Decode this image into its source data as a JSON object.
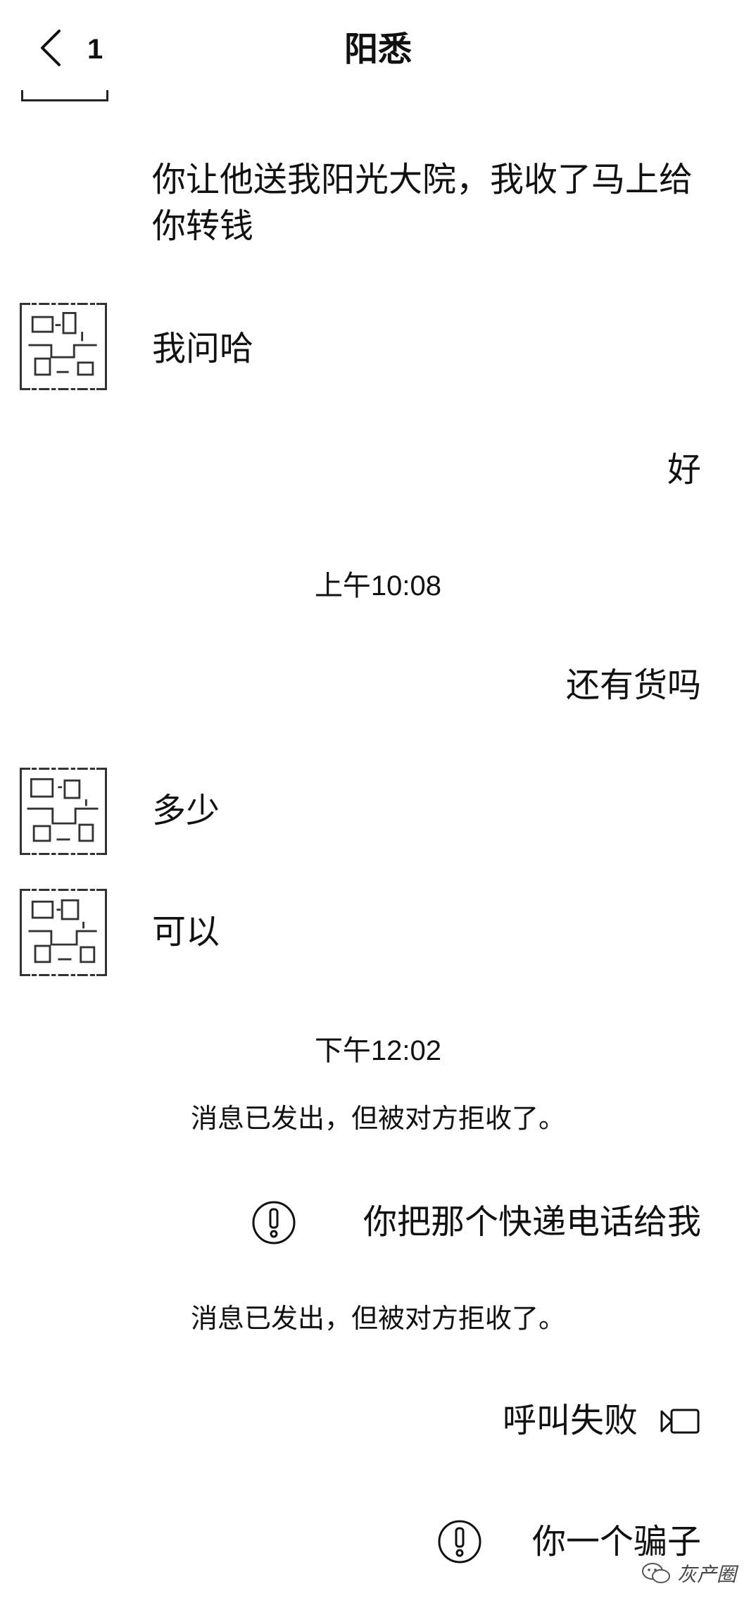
{
  "header": {
    "unread_count": "1",
    "title": "阳悉"
  },
  "messages": [
    {
      "side": "right",
      "text": "你让他送我阳光大院，我收了马上给你转钱"
    },
    {
      "side": "left",
      "text": "我问哈"
    },
    {
      "side": "right",
      "text": "好"
    },
    {
      "type": "time",
      "text": "上午10:08"
    },
    {
      "side": "right",
      "text": "还有货吗"
    },
    {
      "side": "left",
      "text": "多少"
    },
    {
      "side": "left",
      "text": "可以"
    },
    {
      "type": "time",
      "text": "下午12:02"
    },
    {
      "type": "notice",
      "text": "消息已发出，但被对方拒收了。"
    },
    {
      "side": "right",
      "text": "你把那个快递电话给我",
      "failed": true
    },
    {
      "type": "notice",
      "text": "消息已发出，但被对方拒收了。"
    },
    {
      "side": "right",
      "text": "呼叫失败",
      "call": true
    },
    {
      "side": "right",
      "text": "你一个骗子",
      "failed": true
    }
  ],
  "watermark": {
    "text": "灰产圈"
  },
  "icons": {
    "back": "chevron-left-icon",
    "failed": "exclamation-circle-icon",
    "call": "video-call-icon",
    "watermark": "wechat-icon"
  }
}
